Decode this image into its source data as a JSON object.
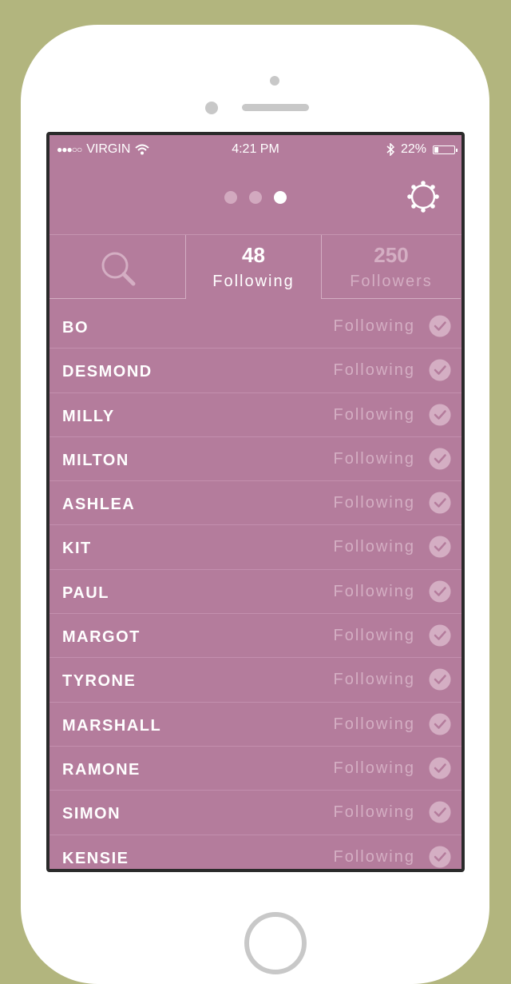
{
  "status_bar": {
    "carrier": "VIRGIN",
    "signal": "●●●○○",
    "time": "4:21 PM",
    "battery": "22%",
    "battery_level": 0.22
  },
  "pager": {
    "pages": 3,
    "active_index": 2
  },
  "tabs": {
    "following": {
      "count": "48",
      "label": "Following"
    },
    "followers": {
      "count": "250",
      "label": "Followers"
    }
  },
  "list": {
    "items": [
      {
        "name": "BO",
        "status": "Following"
      },
      {
        "name": "DESMOND",
        "status": "Following"
      },
      {
        "name": "MILLY",
        "status": "Following"
      },
      {
        "name": "MILTON",
        "status": "Following"
      },
      {
        "name": "ASHLEA",
        "status": "Following"
      },
      {
        "name": "KIT",
        "status": "Following"
      },
      {
        "name": "PAUL",
        "status": "Following"
      },
      {
        "name": "MARGOT",
        "status": "Following"
      },
      {
        "name": "TYRONE",
        "status": "Following"
      },
      {
        "name": "MARSHALL",
        "status": "Following"
      },
      {
        "name": "RAMONE",
        "status": "Following"
      },
      {
        "name": "SIMON",
        "status": "Following"
      },
      {
        "name": "KENSIE",
        "status": "Following"
      }
    ]
  },
  "colors": {
    "background": "#b2b57e",
    "screen": "#b47c9c",
    "muted": "#d4aec3",
    "text": "#ffffff"
  },
  "icons": {
    "wifi": "wifi-icon",
    "bluetooth": "bluetooth-icon",
    "settings": "sun-gear-icon",
    "search": "search-icon",
    "check": "check-circle-icon"
  }
}
